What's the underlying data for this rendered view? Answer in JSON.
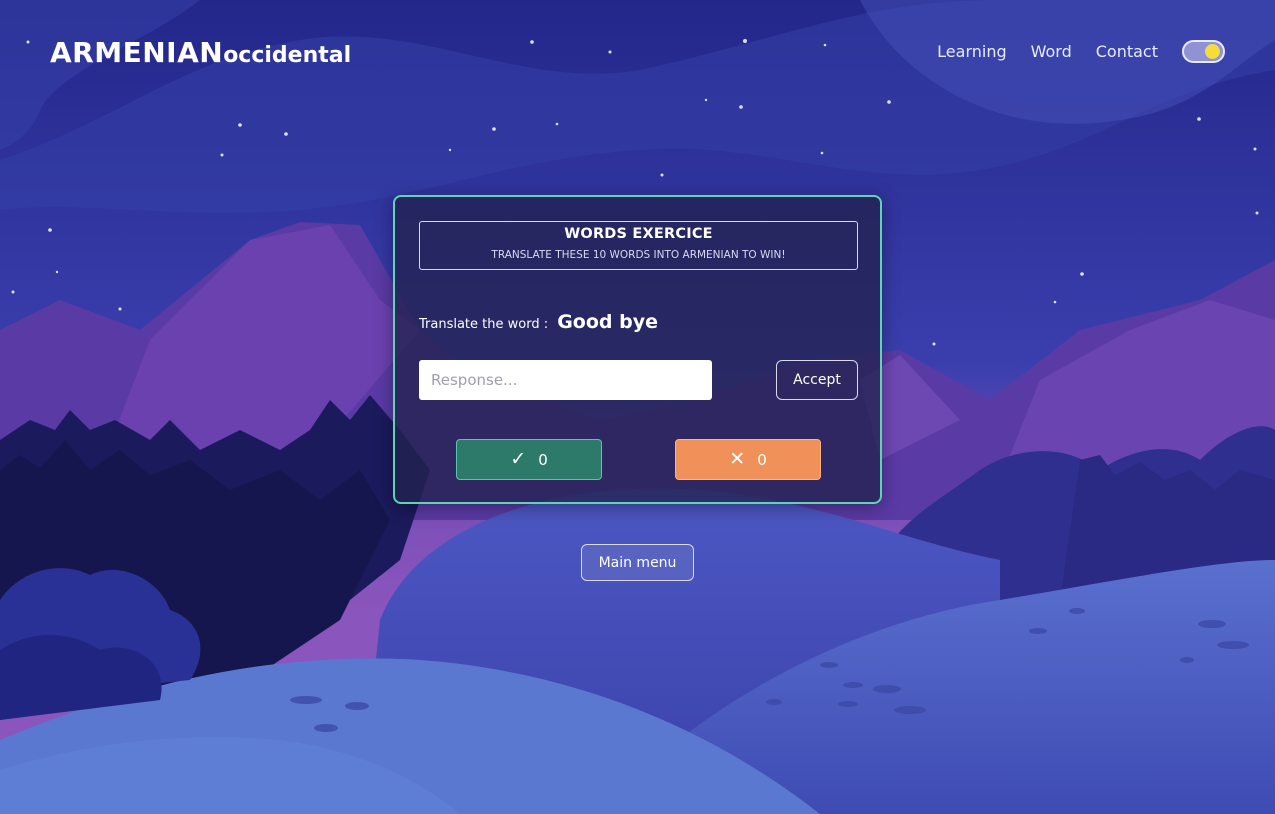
{
  "header": {
    "brand_part1": "ARMENIAN",
    "brand_part2": "occidental",
    "nav": [
      "Learning",
      "Word",
      "Contact"
    ],
    "theme_toggle": "dark-mode-toggle"
  },
  "card": {
    "title": "WORDS EXERCICE",
    "subtitle": "TRANSLATE THESE 10 WORDS INTO ARMENIAN TO WIN!",
    "prompt_label": "Translate the word :",
    "prompt_word": "Good bye",
    "response_placeholder": "Response...",
    "response_value": "",
    "accept_label": "Accept",
    "correct_icon": "check-icon",
    "correct_count": "0",
    "wrong_icon": "cross-icon",
    "wrong_count": "0"
  },
  "footer": {
    "main_menu_label": "Main menu"
  },
  "colors": {
    "accent_border": "#5fd3b4",
    "correct": "#2e7a6a",
    "wrong": "#f0915a",
    "toggle_knob": "#f5dc3a"
  }
}
